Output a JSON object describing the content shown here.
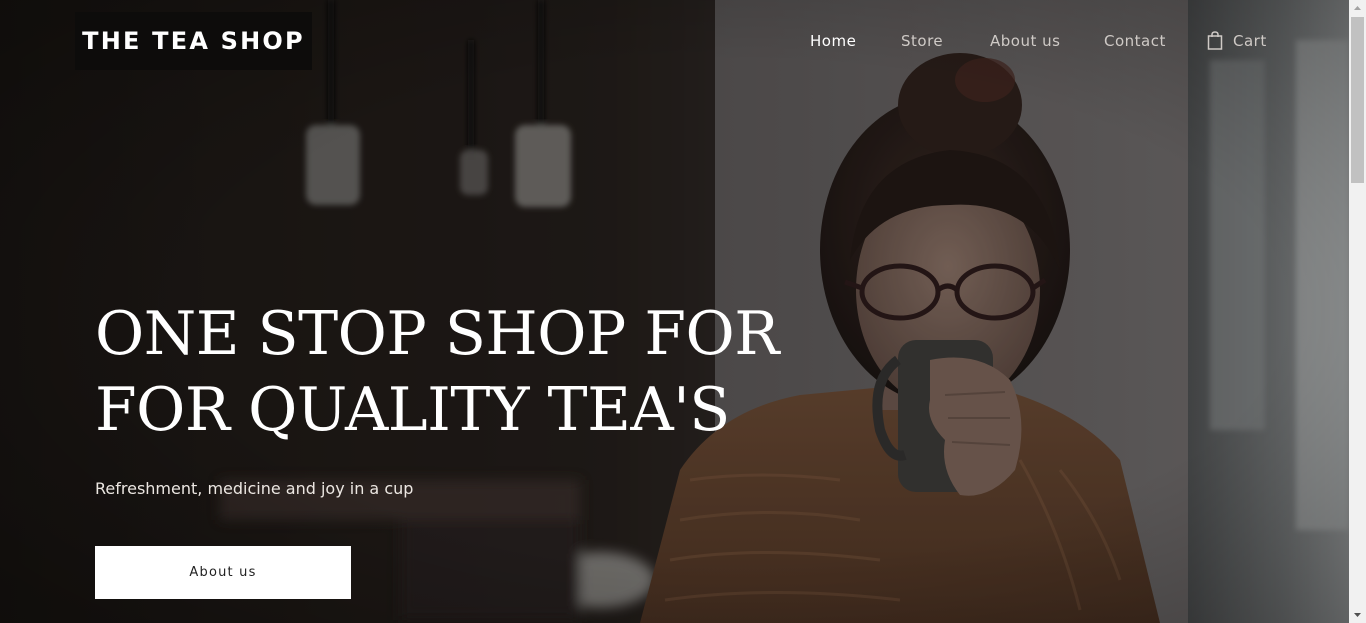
{
  "brand": {
    "logo_text": "THE TEA SHOP"
  },
  "nav": {
    "items": [
      {
        "label": "Home",
        "active": true
      },
      {
        "label": "Store",
        "active": false
      },
      {
        "label": "About us",
        "active": false
      },
      {
        "label": "Contact",
        "active": false
      }
    ],
    "cart": {
      "label": "Cart",
      "icon": "shopping-bag-icon"
    }
  },
  "hero": {
    "headline_lines": [
      "ONE STOP SHOP FOR",
      "FOR QUALITY TEA'S"
    ],
    "subtitle": "Refreshment, medicine and joy in a cup",
    "cta_label": "About us",
    "image": "woman-drinking-tea-photo"
  },
  "colors": {
    "logo_bg": "#0d0c0b",
    "nav_text": "#cfcac6",
    "nav_active": "#ffffff",
    "cta_bg": "#ffffff",
    "hero_overlay": "#1c1816"
  }
}
